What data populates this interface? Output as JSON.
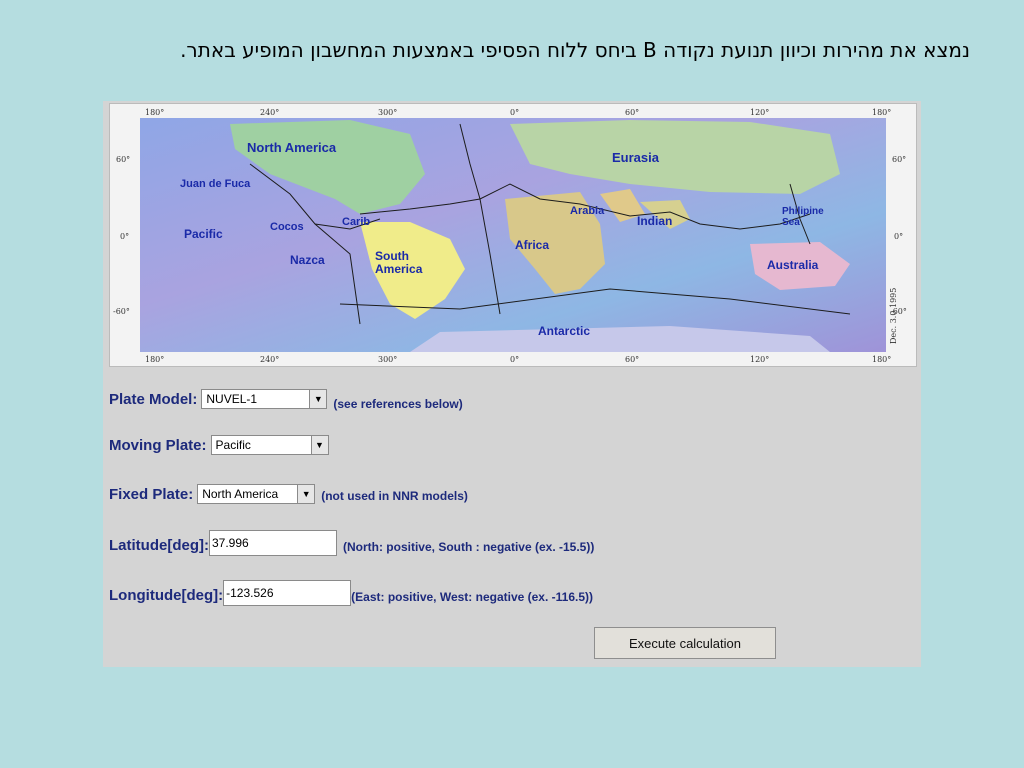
{
  "slide": {
    "title": "נמצא את מהירות וכיוון תנועת נקודה B ביחס ללוח הפסיפי באמצעות המחשבון המופיע באתר."
  },
  "map": {
    "top_ticks": [
      "180°",
      "240°",
      "300°",
      "0°",
      "60°",
      "120°",
      "180°"
    ],
    "bottom_ticks": [
      "180°",
      "240°",
      "300°",
      "0°",
      "60°",
      "120°",
      "180°"
    ],
    "left_ticks": [
      "60°",
      "0°",
      "-60°"
    ],
    "right_ticks": [
      "60°",
      "0°",
      "-60°"
    ],
    "credit": "Dec. 3.0 1995",
    "plates": {
      "north_america": "North America",
      "eurasia": "Eurasia",
      "juan_de_fuca": "Juan de Fuca",
      "arabia": "Arabia",
      "philippine": "Philipine",
      "philippine2": "Sea",
      "cocos": "Cocos",
      "carib": "Carib",
      "indian": "Indian",
      "pacific": "Pacific",
      "africa": "Africa",
      "south_america": "South",
      "south_america2": "America",
      "nazca": "Nazca",
      "australia": "Australia",
      "antarctic": "Antarctic"
    }
  },
  "form": {
    "plate_model": {
      "label": "Plate Model:",
      "value": "NUVEL-1",
      "note": "(see references below)"
    },
    "moving_plate": {
      "label": "Moving Plate:",
      "value": "Pacific"
    },
    "fixed_plate": {
      "label": "Fixed Plate:",
      "value": "North America",
      "note": "(not used in NNR models)"
    },
    "latitude": {
      "label": "Latitude[deg]:",
      "value": "37.996",
      "note": "(North: positive, South : negative (ex. -15.5))"
    },
    "longitude": {
      "label": "Longitude[deg]:",
      "value": "-123.526",
      "note": "(East: positive, West: negative (ex. -116.5))"
    },
    "execute_label": "Execute calculation"
  }
}
